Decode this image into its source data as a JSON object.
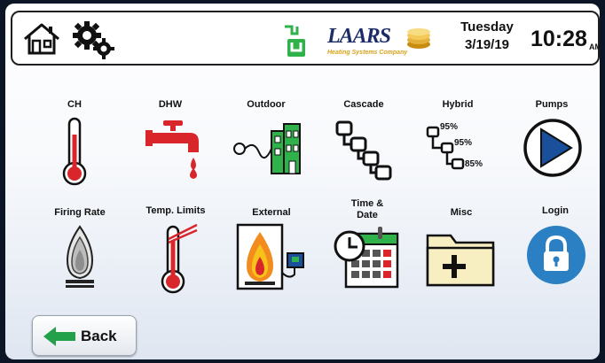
{
  "header": {
    "brand_name": "LAARS",
    "brand_sub": "Heating Systems Company",
    "day": "Tuesday",
    "date": "3/19/19",
    "time": "10:28",
    "ampm": "AM"
  },
  "tiles": [
    {
      "label": "CH"
    },
    {
      "label": "DHW"
    },
    {
      "label": "Outdoor"
    },
    {
      "label": "Cascade"
    },
    {
      "label": "Hybrid",
      "percents": [
        "95%",
        "95%",
        "85%"
      ]
    },
    {
      "label": "Pumps"
    },
    {
      "label": "Firing Rate"
    },
    {
      "label": "Temp. Limits"
    },
    {
      "label": "External"
    },
    {
      "label": "Time & Date",
      "label_line1": "Time &",
      "label_line2": "Date"
    },
    {
      "label": "Misc"
    },
    {
      "label": "Login"
    }
  ],
  "back_button": {
    "label": "Back"
  },
  "colors": {
    "thermometer_red": "#d9262b",
    "outdoor_green": "#2fb24a",
    "pump_blue": "#1a4f9c",
    "login_blue": "#2b7fc3",
    "folder_yellow": "#f7efc2",
    "back_arrow_green": "#23a04a",
    "brand_gold": "#d8a31c"
  }
}
